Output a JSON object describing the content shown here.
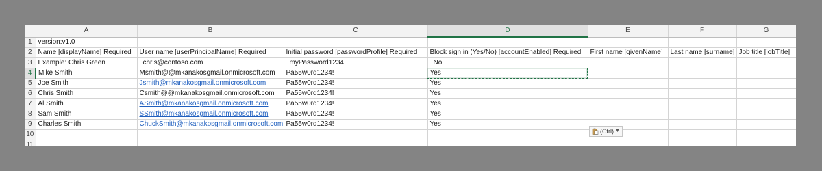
{
  "columns": [
    "A",
    "B",
    "C",
    "D",
    "E",
    "F",
    "G"
  ],
  "selected_column": "D",
  "selected_row": 4,
  "rows": [
    {
      "num": "1",
      "cells": [
        "version:v1.0",
        "",
        "",
        "",
        "",
        "",
        ""
      ]
    },
    {
      "num": "2",
      "cells": [
        "Name [displayName] Required",
        "User name [userPrincipalName] Required",
        "Initial password [passwordProfile] Required",
        "Block sign in (Yes/No) [accountEnabled] Required",
        "First name [givenName]",
        "Last name [surname]",
        "Job title [jobTitle]"
      ]
    },
    {
      "num": "3",
      "cells": [
        "Example: Chris Green",
        "chris@contoso.com",
        "myPassword1234",
        "No",
        "",
        "",
        ""
      ]
    },
    {
      "num": "4",
      "cells": [
        "Mike Smith",
        "Msmith@@mkanakosgmail.onmicrosoft.com",
        "Pa55w0rd1234!",
        "Yes",
        "",
        "",
        ""
      ]
    },
    {
      "num": "5",
      "cells": [
        "Joe Smith",
        "Jsmith@mkanakosgmail.onmicrosoft.com",
        "Pa55w0rd1234!",
        "Yes",
        "",
        "",
        ""
      ]
    },
    {
      "num": "6",
      "cells": [
        "Chris Smith",
        "Csmith@@mkanakosgmail.onmicrosoft.com",
        "Pa55w0rd1234!",
        "Yes",
        "",
        "",
        ""
      ]
    },
    {
      "num": "7",
      "cells": [
        "Al Smith",
        "ASmith@mkanakosgmail.onmicrosoft.com",
        "Pa55w0rd1234!",
        "Yes",
        "",
        "",
        ""
      ]
    },
    {
      "num": "8",
      "cells": [
        "Sam Smith",
        "SSmith@mkanakosgmail.onmicrosoft.com",
        "Pa55w0rd1234!",
        "Yes",
        "",
        "",
        ""
      ]
    },
    {
      "num": "9",
      "cells": [
        "Charles Smith",
        "ChuckSmith@mkanakosgmail.onmicrosoft.com",
        "Pa55w0rd1234!",
        "Yes",
        "",
        "",
        ""
      ]
    },
    {
      "num": "10",
      "cells": [
        "",
        "",
        "",
        "",
        "",
        "",
        ""
      ]
    },
    {
      "num": "11",
      "cells": [
        "",
        "",
        "",
        "",
        "",
        "",
        ""
      ]
    }
  ],
  "hyperlink_cells": [
    "5-1",
    "7-1",
    "8-1",
    "9-1"
  ],
  "indented_cells": [
    "3-1",
    "3-2",
    "3-3"
  ],
  "paste_options": {
    "label": "(Ctrl)",
    "icon": "clipboard-icon"
  },
  "colors": {
    "selection": "#217346",
    "hyperlink": "#1f5fbf",
    "background": "#848484"
  }
}
